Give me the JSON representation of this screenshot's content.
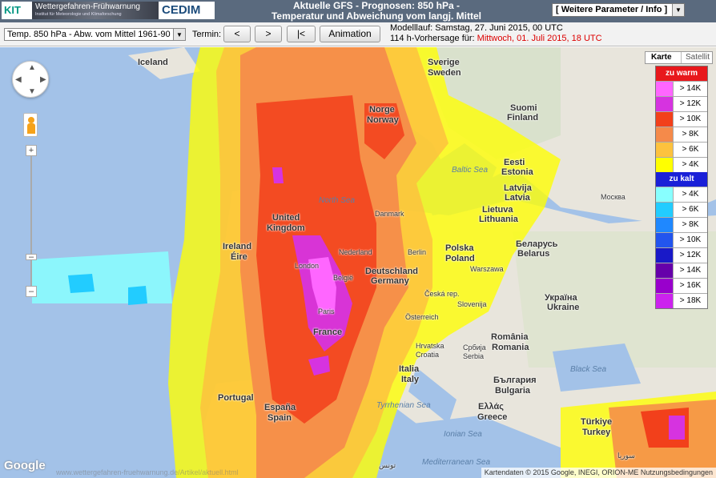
{
  "header": {
    "kit_logo": "KIT",
    "wfw_title": "Wettergefahren-Frühwarnung",
    "wfw_sub": "Institut für Meteorologie und Klimaforschung",
    "cedim_logo": "CEDIM",
    "title_line1": "Aktuelle GFS - Prognosen: 850 hPa -",
    "title_line2": "Temperatur und Abweichung vom langj. Mittel",
    "param_select": "[ Weitere Parameter / Info ]"
  },
  "toolbar": {
    "variable_select": "Temp. 850 hPa - Abw. vom Mittel 1961-90",
    "termin_label": "Termin:",
    "prev_label": "<",
    "next_label": ">",
    "first_label": "|<",
    "animation_label": "Animation",
    "run_label": "Modelllauf: Samstag, 27. Juni 2015, 00 UTC",
    "forecast_prefix": "114 h-Vorhersage für: ",
    "forecast_time": "Mittwoch, 01. Juli 2015, 18 UTC"
  },
  "map": {
    "map_type": {
      "karte": "Karte",
      "satellit": "Satellit"
    },
    "labels": {
      "iceland": "Iceland",
      "sverige1": "Sverige",
      "sverige2": "Sweden",
      "norge1": "Norge",
      "norge2": "Norway",
      "suomi1": "Suomi",
      "suomi2": "Finland",
      "eesti1": "Eesti",
      "eesti2": "Estonia",
      "latvija1": "Latvija",
      "latvija2": "Latvia",
      "lietuva1": "Lietuva",
      "lietuva2": "Lithuania",
      "moskva": "Москва",
      "danmark": "Danmark",
      "uk1": "United",
      "uk2": "Kingdom",
      "ireland1": "Ireland",
      "ireland2": "Éire",
      "london": "London",
      "nederland": "Nederland",
      "belgie": "België",
      "paris": "Paris",
      "france": "France",
      "deutschland1": "Deutschland",
      "deutschland2": "Germany",
      "polska1": "Polska",
      "polska2": "Poland",
      "warszawa": "Warszawa",
      "belarus1": "Беларусь",
      "belarus2": "Belarus",
      "ukraina1": "Україна",
      "ukraina2": "Ukraine",
      "cesko": "Česká rep.",
      "osterreich": "Österreich",
      "hrvatska": "Hrvatska",
      "croatia": "Croatia",
      "srbija": "Србија",
      "serbia": "Serbia",
      "romania": "România",
      "romania2": "Romania",
      "italia": "Italia",
      "italy": "Italy",
      "bulgaria1": "България",
      "bulgaria2": "Bulgaria",
      "portugal": "Portugal",
      "espana": "España",
      "spain": "Spain",
      "ellas": "Ελλάς",
      "greece": "Greece",
      "turkiye": "Türkiye",
      "turkey": "Turkey",
      "north_sea": "North Sea",
      "baltic_sea": "Baltic Sea",
      "black_sea": "Black Sea",
      "tyrrhenian": "Tyrrhenian Sea",
      "ionian": "Ionian Sea",
      "med_sea": "Mediterranean Sea",
      "berlin": "Berlin",
      "slovenia": "Slovenija",
      "suriya": "سوريا",
      "tunes": "تونس"
    }
  },
  "legend": {
    "warm_title": "zu warm",
    "warm": [
      {
        "label": "> 14K",
        "color": "#ff66ff"
      },
      {
        "label": "> 12K",
        "color": "#d633e0"
      },
      {
        "label": "> 10K",
        "color": "#f2401b"
      },
      {
        "label": "> 8K",
        "color": "#f58a4a"
      },
      {
        "label": "> 6K",
        "color": "#fdc23e"
      },
      {
        "label": "> 4K",
        "color": "#ffff00"
      }
    ],
    "cold_title": "zu kalt",
    "cold": [
      {
        "label": "> 4K",
        "color": "#88ffff"
      },
      {
        "label": "> 6K",
        "color": "#22ccff"
      },
      {
        "label": "> 8K",
        "color": "#1f88ff"
      },
      {
        "label": "> 10K",
        "color": "#2255ee"
      },
      {
        "label": "> 12K",
        "color": "#1919c8"
      },
      {
        "label": "> 14K",
        "color": "#6600aa"
      },
      {
        "label": "> 16K",
        "color": "#9900cc"
      },
      {
        "label": "> 18K",
        "color": "#cc22ee"
      }
    ],
    "warm_head_color": "#e8181c",
    "cold_head_color": "#1a20d8"
  },
  "footer": {
    "google": "Google",
    "attribution": "Kartendaten © 2015 Google, INEGI, ORION-ME     Nutzungsbedingungen",
    "url": "www.wettergefahren-fruehwarnung.de/Artikel/aktuell.html"
  }
}
